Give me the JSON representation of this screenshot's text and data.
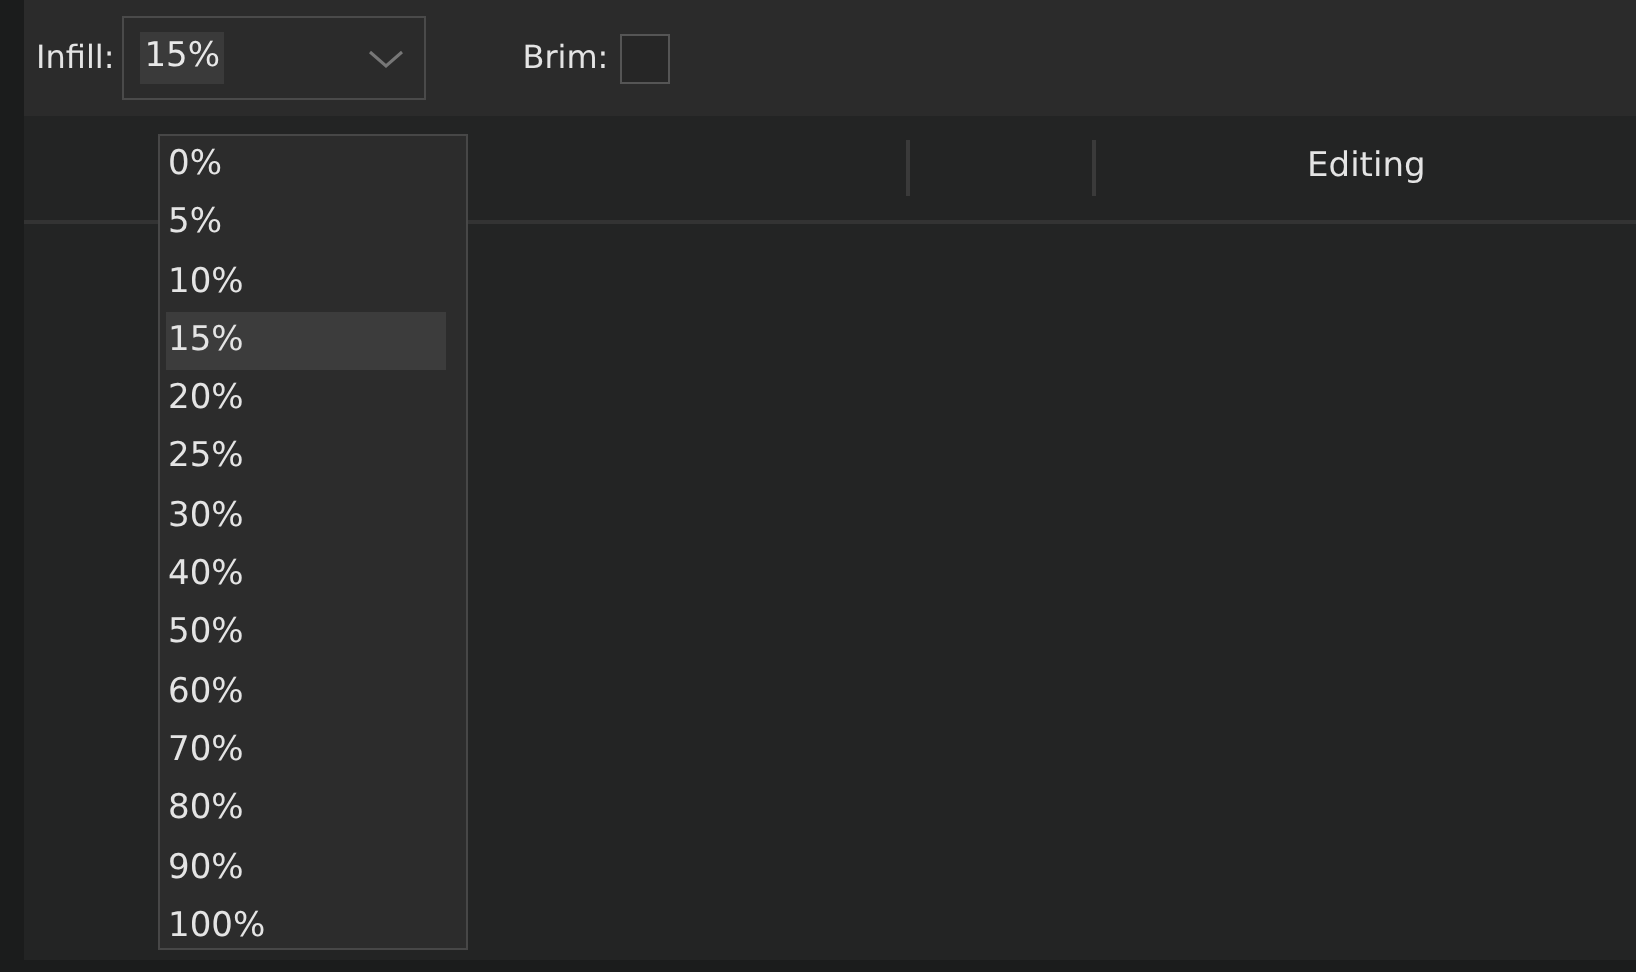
{
  "toolbar": {
    "infill_label": "Infill:",
    "infill_value": "15%",
    "brim_label": "Brim:",
    "brim_checked": false
  },
  "table": {
    "columns": [
      {
        "kind": "blank"
      },
      {
        "kind": "blank"
      },
      {
        "kind": "text",
        "label": "Editing"
      }
    ]
  },
  "infill_menu": {
    "options": [
      {
        "label": "0%",
        "selected": false
      },
      {
        "label": "5%",
        "selected": false
      },
      {
        "label": "10%",
        "selected": false
      },
      {
        "label": "15%",
        "selected": true
      },
      {
        "label": "20%",
        "selected": false
      },
      {
        "label": "25%",
        "selected": false
      },
      {
        "label": "30%",
        "selected": false
      },
      {
        "label": "40%",
        "selected": false
      },
      {
        "label": "50%",
        "selected": false
      },
      {
        "label": "60%",
        "selected": false
      },
      {
        "label": "70%",
        "selected": false
      },
      {
        "label": "80%",
        "selected": false
      },
      {
        "label": "90%",
        "selected": false
      },
      {
        "label": "100%",
        "selected": false
      }
    ]
  }
}
